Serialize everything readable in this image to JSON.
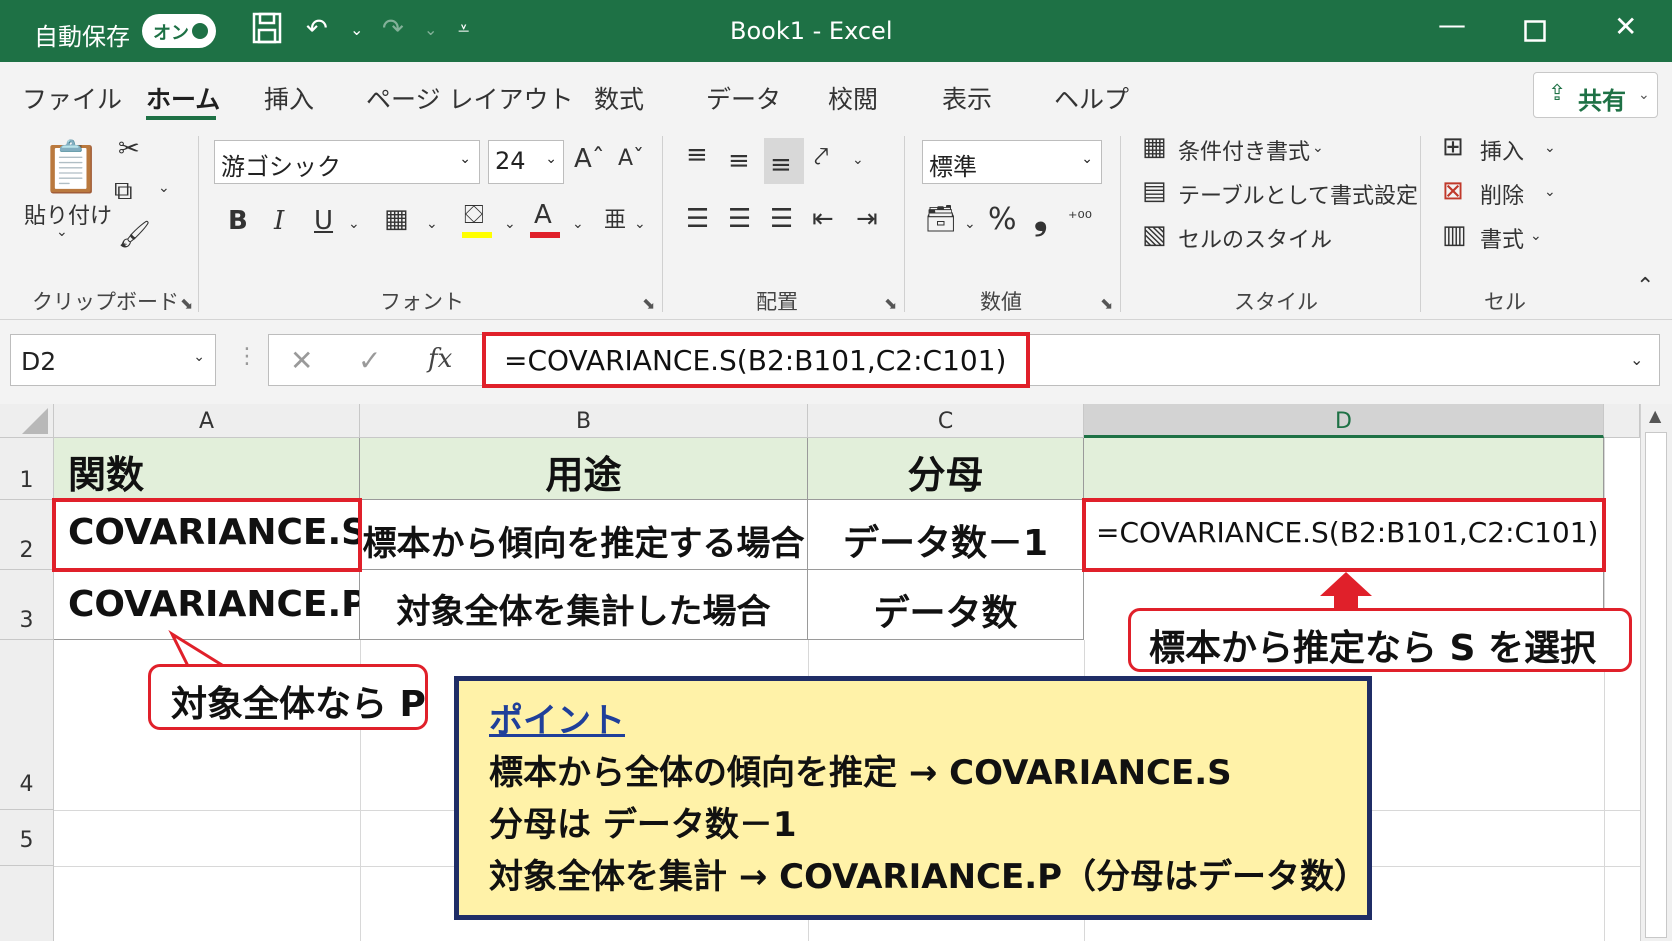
{
  "titlebar": {
    "autosave_label": "自動保存",
    "autosave_state": "オン",
    "title": "Book1  -  Excel",
    "qat_icons": [
      "save-icon",
      "undo-icon",
      "redo-icon",
      "customize-icon"
    ],
    "window_controls": [
      "minimize-icon",
      "maximize-icon",
      "close-icon"
    ]
  },
  "tabs": [
    "ファイル",
    "ホーム",
    "挿入",
    "ページ レイアウト",
    "数式",
    "データ",
    "校閲",
    "表示",
    "ヘルプ"
  ],
  "active_tab": "ホーム",
  "share_label": "共有",
  "ribbon": {
    "clipboard": {
      "paste_label": "貼り付け",
      "group_label": "クリップボード"
    },
    "font": {
      "name": "游ゴシック",
      "size": "24",
      "group_label": "フォント",
      "bold": "B",
      "italic": "I",
      "underline": "U"
    },
    "alignment": {
      "group_label": "配置"
    },
    "number": {
      "format": "標準",
      "percent": "%",
      "comma": "❟",
      "group_label": "数値"
    },
    "styles": {
      "conditional": "条件付き書式",
      "table": "テーブルとして書式設定",
      "cell_styles": "セルのスタイル",
      "group_label": "スタイル"
    },
    "cells": {
      "insert": "挿入",
      "delete": "削除",
      "format": "書式",
      "group_label": "セル"
    }
  },
  "formula_bar": {
    "name_box": "D2",
    "fx": "fx",
    "formula": "=COVARIANCE.S(B2:B101,C2:C101)"
  },
  "sheet": {
    "columns": [
      "A",
      "B",
      "C",
      "D"
    ],
    "rows": [
      "1",
      "2",
      "3",
      "4",
      "5"
    ],
    "cells": {
      "A1": "関数",
      "B1": "用途",
      "C1": "分母",
      "D1": "",
      "A2": "COVARIANCE.S",
      "B2": "標本から傾向を推定する場合",
      "C2": "データ数－1",
      "D2": "=COVARIANCE.S(B2:B101,C2:C101)",
      "A3": "COVARIANCE.P",
      "B3": "対象全体を集計した場合",
      "C3": "データ数",
      "D3": ""
    }
  },
  "callouts": {
    "select_s": "標本から推定なら S を選択",
    "whole_p": "対象全体なら P"
  },
  "point_box": {
    "title": "ポイント",
    "line1": "標本から全体の傾向を推定 → COVARIANCE.S",
    "line2": "分母は データ数－1",
    "line3": "対象全体を集計 → COVARIANCE.P（分母はデータ数）"
  },
  "colors": {
    "excel_green": "#1e7145",
    "highlight_red": "#e0202a",
    "header_fill": "#e2efda",
    "point_fill": "#fff2a8",
    "point_border": "#1f2d66"
  }
}
